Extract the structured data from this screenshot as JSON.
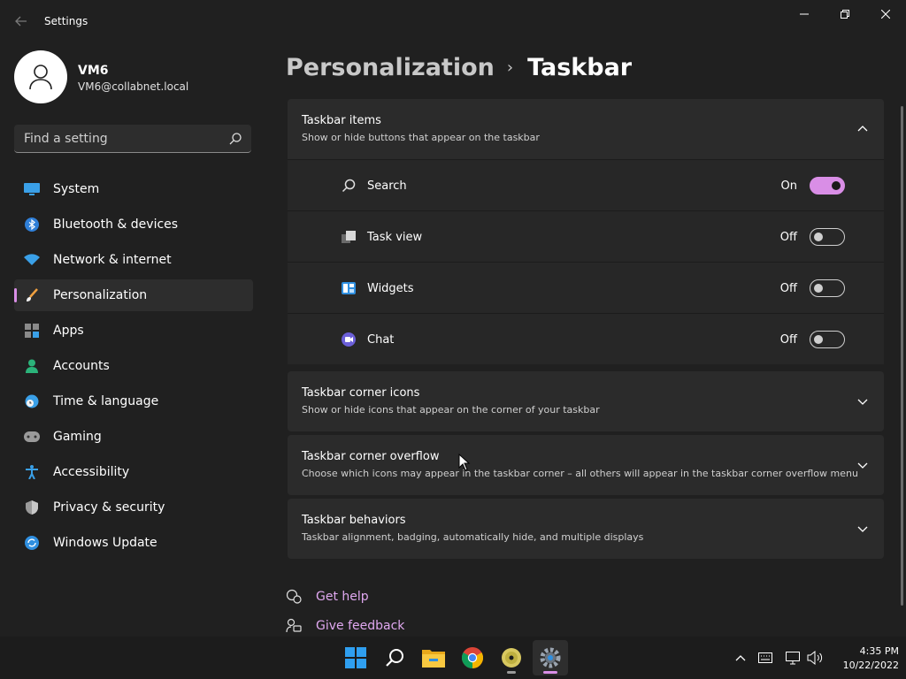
{
  "window": {
    "title": "Settings",
    "controls": [
      "minimize",
      "restore",
      "close"
    ]
  },
  "profile": {
    "name": "VM6",
    "email": "VM6@collabnet.local"
  },
  "search": {
    "placeholder": "Find a setting"
  },
  "sidebar": {
    "items": [
      {
        "label": "System",
        "icon": "monitor-icon"
      },
      {
        "label": "Bluetooth & devices",
        "icon": "bluetooth-icon"
      },
      {
        "label": "Network & internet",
        "icon": "wifi-icon"
      },
      {
        "label": "Personalization",
        "icon": "brush-icon",
        "selected": true
      },
      {
        "label": "Apps",
        "icon": "apps-icon"
      },
      {
        "label": "Accounts",
        "icon": "person-icon"
      },
      {
        "label": "Time & language",
        "icon": "clock-globe-icon"
      },
      {
        "label": "Gaming",
        "icon": "gamepad-icon"
      },
      {
        "label": "Accessibility",
        "icon": "accessibility-icon"
      },
      {
        "label": "Privacy & security",
        "icon": "shield-icon"
      },
      {
        "label": "Windows Update",
        "icon": "update-icon"
      }
    ]
  },
  "breadcrumb": {
    "parent": "Personalization",
    "separator": "›",
    "current": "Taskbar"
  },
  "sections": {
    "taskbar_items": {
      "title": "Taskbar items",
      "description": "Show or hide buttons that appear on the taskbar",
      "expanded": true,
      "rows": [
        {
          "label": "Search",
          "state": "On",
          "on": true,
          "icon": "search-icon"
        },
        {
          "label": "Task view",
          "state": "Off",
          "on": false,
          "icon": "task-view-icon"
        },
        {
          "label": "Widgets",
          "state": "Off",
          "on": false,
          "icon": "widgets-icon"
        },
        {
          "label": "Chat",
          "state": "Off",
          "on": false,
          "icon": "chat-icon"
        }
      ]
    },
    "corner_icons": {
      "title": "Taskbar corner icons",
      "description": "Show or hide icons that appear on the corner of your taskbar"
    },
    "corner_overflow": {
      "title": "Taskbar corner overflow",
      "description": "Choose which icons may appear in the taskbar corner – all others will appear in the taskbar corner overflow menu"
    },
    "behaviors": {
      "title": "Taskbar behaviors",
      "description": "Taskbar alignment, badging, automatically hide, and multiple displays"
    }
  },
  "links": {
    "help": "Get help",
    "feedback": "Give feedback"
  },
  "taskbar": {
    "apps": [
      "start-icon",
      "search-icon",
      "file-explorer-icon",
      "chrome-icon",
      "disc-icon",
      "settings-icon"
    ],
    "clock": {
      "time": "4:35 PM",
      "date": "10/22/2022"
    }
  },
  "colors": {
    "accent": "#d98ee6",
    "background": "#202020",
    "card": "#2b2b2b"
  }
}
